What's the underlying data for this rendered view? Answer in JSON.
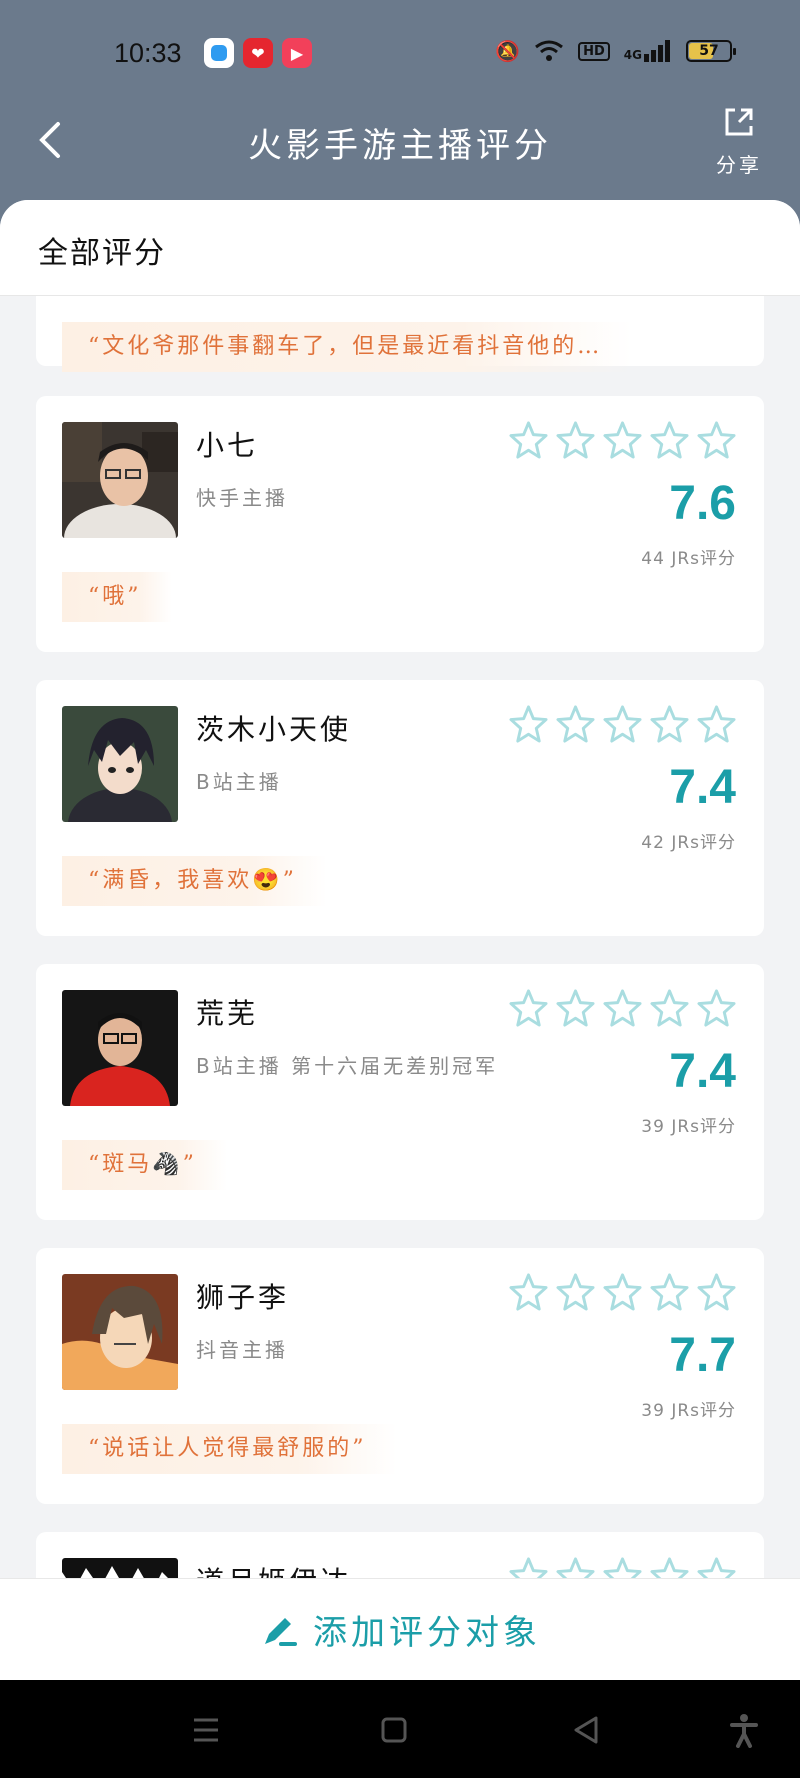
{
  "status": {
    "time": "10:33",
    "hd": "HD",
    "signal": "4G",
    "battery": "57"
  },
  "header": {
    "title": "火影手游主播评分",
    "share_label": "分享"
  },
  "section_title": "全部评分",
  "partial_card_quote": "“文化爷那件事翻车了，但是最近看抖音他的…",
  "cards": [
    {
      "name": "小七",
      "sub": "快手主播",
      "score": "7.6",
      "count": "44 JRs评分",
      "quote": "“哦”"
    },
    {
      "name": "茨木小天使",
      "sub": "B站主播",
      "score": "7.4",
      "count": "42 JRs评分",
      "quote": "“满昏，我喜欢😍”"
    },
    {
      "name": "荒芜",
      "sub": "B站主播 第十六届无差别冠军",
      "score": "7.4",
      "count": "39 JRs评分",
      "quote": "“斑马🦓”"
    },
    {
      "name": "狮子李",
      "sub": "抖音主播",
      "score": "7.7",
      "count": "39 JRs评分",
      "quote": "“说话让人觉得最舒服的”"
    },
    {
      "name": "道月姬伊达",
      "sub": "",
      "score": "",
      "count": "",
      "quote": ""
    }
  ],
  "add_button": "添加评分对象",
  "colors": {
    "accent": "#1b9ea8",
    "quote_text": "#e0723a",
    "header_bg": "#6b7a8c"
  },
  "icons": [
    "back-icon",
    "share-icon",
    "star-outline-icon",
    "pen-icon",
    "menu-icon",
    "home-icon",
    "back-triangle-icon",
    "accessibility-icon"
  ]
}
